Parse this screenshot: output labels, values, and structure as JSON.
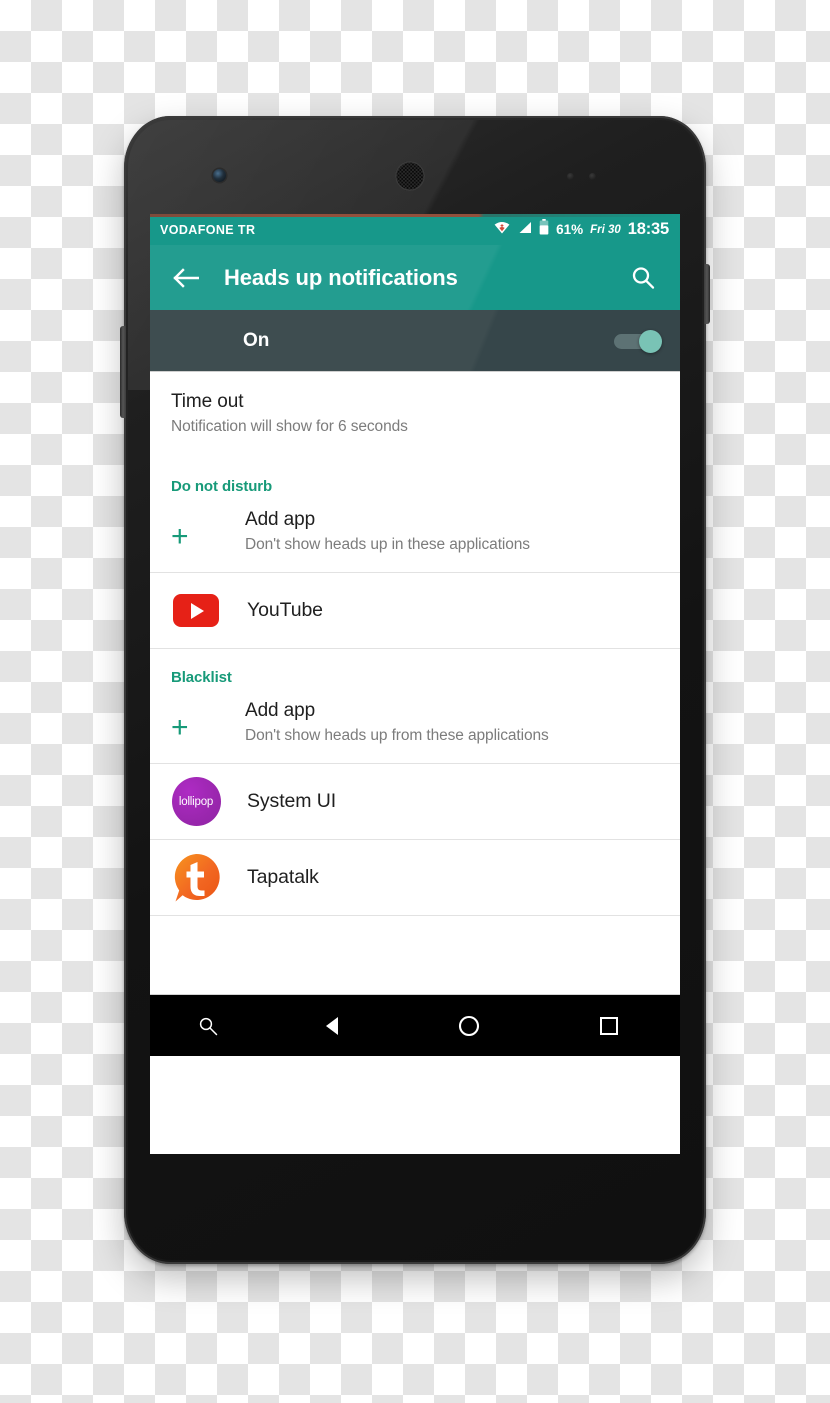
{
  "device": {
    "name": "android-smartphone",
    "hardware": {
      "front_camera": "front-camera",
      "earpiece": "earpiece-speaker",
      "power_button": "power-button",
      "volume_button": "volume-rocker"
    }
  },
  "colors": {
    "app_bar_teal": "#17988a",
    "accent_green": "#179a79",
    "switch_row_dark": "#3e4d50",
    "switch_thumb": "#79c3b5",
    "youtube_red": "#e62117",
    "lollipop_purple": "#9c27b0",
    "tapatalk_orange": "#f26722",
    "nav_bar_black": "#000000",
    "text_primary": "#1f1f1f",
    "text_secondary": "#7c7c7c"
  },
  "status_bar": {
    "carrier": "VODAFONE TR",
    "icons": [
      "wifi-icon",
      "signal-icon",
      "battery-icon"
    ],
    "battery_percent": "61%",
    "date": "Fri 30",
    "time": "18:35"
  },
  "app_bar": {
    "back_icon": "back-arrow-icon",
    "title": "Heads up notifications",
    "search_icon": "search-icon"
  },
  "master_switch": {
    "label": "On",
    "state": "on"
  },
  "settings": {
    "timeout": {
      "title": "Time out",
      "subtitle": "Notification will show for 6 seconds"
    }
  },
  "sections": [
    {
      "header": "Do not disturb",
      "add_app": {
        "icon": "plus-icon",
        "title": "Add app",
        "subtitle": "Don't show heads up in these applications"
      },
      "apps": [
        {
          "name": "YouTube",
          "icon": "youtube-icon"
        }
      ]
    },
    {
      "header": "Blacklist",
      "add_app": {
        "icon": "plus-icon",
        "title": "Add app",
        "subtitle": "Don't show heads up from these applications"
      },
      "apps": [
        {
          "name": "System UI",
          "icon": "lollipop-icon",
          "icon_label": "lollipop"
        },
        {
          "name": "Tapatalk",
          "icon": "tapatalk-icon",
          "icon_label": "t"
        }
      ]
    }
  ],
  "nav_bar": {
    "buttons": [
      {
        "label": "Search",
        "icon": "search-icon"
      },
      {
        "label": "Back",
        "icon": "back-triangle-icon"
      },
      {
        "label": "Home",
        "icon": "home-circle-icon"
      },
      {
        "label": "Recents",
        "icon": "recents-square-icon"
      }
    ]
  }
}
